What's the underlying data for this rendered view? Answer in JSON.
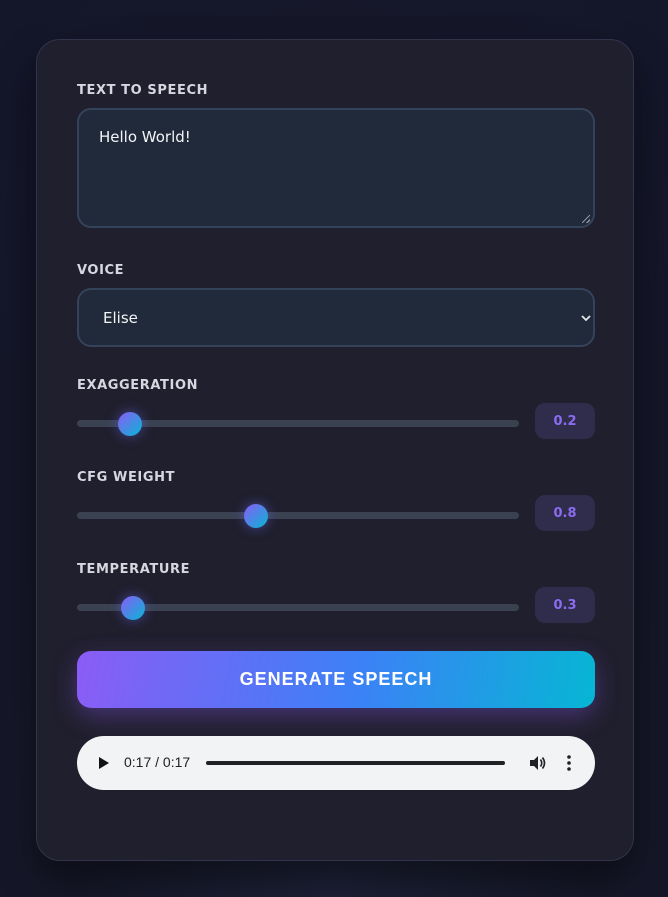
{
  "tts": {
    "text_label": "TEXT TO SPEECH",
    "text_value": "Hello World!",
    "voice_label": "VOICE",
    "voice_selected": "Elise"
  },
  "sliders": [
    {
      "label": "EXAGGERATION",
      "value": "0.2",
      "fraction": 0.12
    },
    {
      "label": "CFG WEIGHT",
      "value": "0.8",
      "fraction": 0.405
    },
    {
      "label": "TEMPERATURE",
      "value": "0.3",
      "fraction": 0.126
    }
  ],
  "generate_label": "GENERATE SPEECH",
  "player": {
    "time": "0:17 / 0:17",
    "progress": 1.0
  },
  "colors": {
    "accent_purple": "#8b5cf6",
    "accent_cyan": "#06b6d4",
    "card_bg": "#201f2d"
  }
}
